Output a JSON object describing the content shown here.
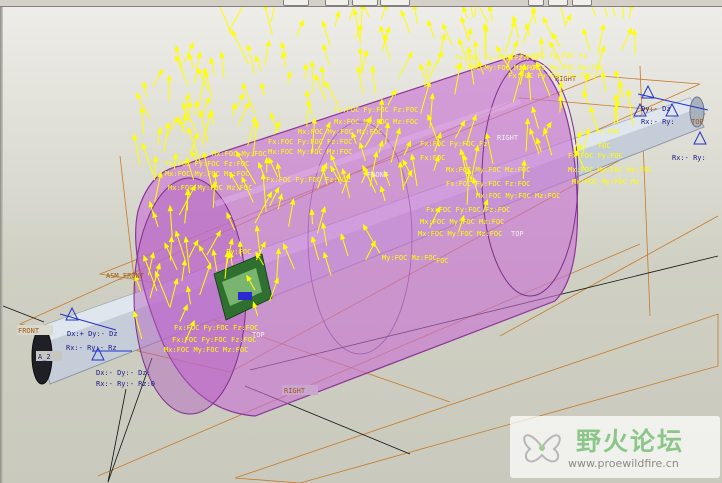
{
  "labels": {
    "front_left": "FRONT",
    "asm_front": "ASM_FRONT",
    "axis_a2": "A_2",
    "right_bottom": "RIGHT",
    "top_mid": "TOP",
    "top_mid2": "TOP",
    "front_mid": "FRONT",
    "right_mid": "RIGHT",
    "top_right": "TOP",
    "right_top": "RIGHT"
  },
  "constraints": {
    "left_dxyz": "Dx:+ Dy:- Dz",
    "left_rxyz": "Rx:- Ry:- Rz",
    "left_rxyz2": "Rx:- Ry:- Rz:0",
    "left_dxyz2": "Dx:- Dy:- Dz:",
    "right_dxyz": "Dy:- Dz",
    "right_rxyz": "Rx:- Ry:",
    "right_rxyz2": "Rx:- Ry:"
  },
  "loads": {
    "l1": "Fx:FOC Fy:FOC Fz:FOC",
    "l2": "Mx:FOC My:FOC Mz:FOC",
    "l3": "Fx:FOC Fy:FOC Fz:FOC",
    "l4": "Mx:FOC My:FOC Mz:FOC",
    "l5": "Fx:FOC Fy:FOC Fz",
    "l6": "Mx:FOC My:FOC Mz:FOC",
    "l7": "Fx:FOC Fy:FOC Fz:FOC",
    "l8": "Fx:FOC Fy:FOC Fz",
    "l9": "Mx:FOC My:FOC Mz:FOC",
    "l10": "Fz:FOC",
    "l11": "Mx:FOC My:FOC Mz:FOC",
    "l12": "Fx:FOC Fy:FOC Fz:FOC",
    "l13": "Mx:FOC My:FOC Mz:FOC",
    "l14": "Fx:FOC Fy:FOC",
    "l15": "Mx:FOC My:FOC Mz:FOC",
    "l16": "Mx:FOC My:FOC Mz",
    "l17": "Fx:FOC Fy:FOC Fz:FOC",
    "l18": "Mx:FOC My:FOC Mz:FOC",
    "l19": "Fx:FOC Fy:FOC Fz:FOC",
    "l20": "Mx:FOC My:FOC Mz:FOC",
    "l21": "Mx:FOC My:FOC Mz:FOC",
    "l22": "Fy:FOC",
    "l23": "My:FOC Mz:FOC",
    "l24": "Fx:FOC Fy:FOC Fz:FOC",
    "l25": "Fx:FOC Fy:FOC Fz:FOC",
    "l26": "Mx:FOC My:FOC Mz:FOC",
    "l27": "Fx:FOC",
    "l28": "FOC",
    "l29": "Mx:FOC My:FOC Mz:FOC",
    "l30": "Mx:FOC My:FOC",
    "l31": "Fx:FOC Fy:FOC Fz:FOC",
    "l32": "Mx:FOC My:FOC Mz:FOC",
    "l33": "Fx:FOC Fy:FOC Fz:FOC",
    "l34": "FOC"
  },
  "watermark": {
    "name": "野火论坛",
    "url": "www.proewildfire.cn"
  },
  "colors": {
    "viewport_bg": "#d9d9cf",
    "cylinder": "#c86fd4",
    "shaft": "#c9d3dd",
    "load_arrows": "#ffff00",
    "datum_lines": "#c87a2a",
    "constraint_glyphs": "#2233cc"
  }
}
